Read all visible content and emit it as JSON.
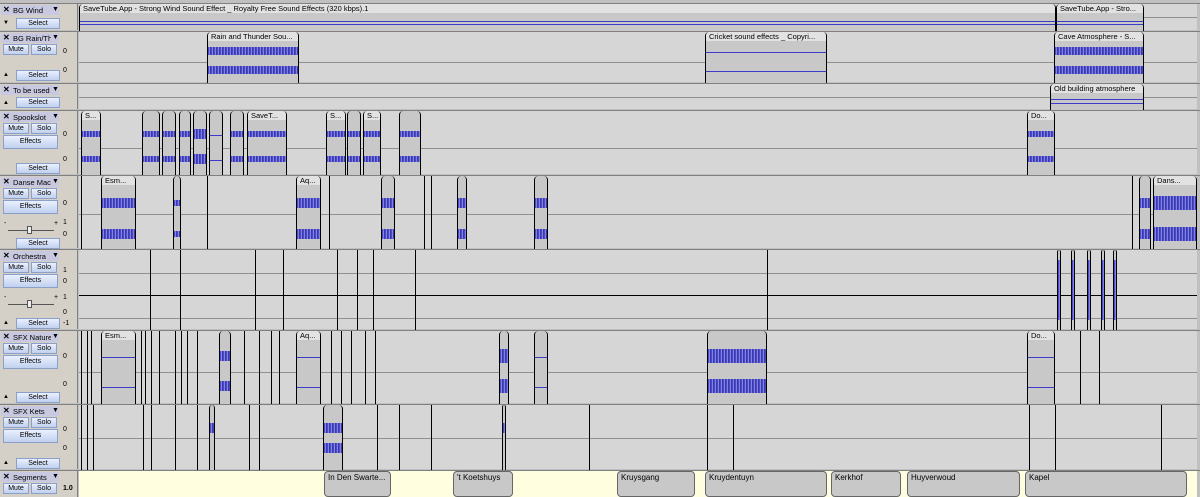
{
  "tracks": [
    {
      "name": "BG Wind",
      "select": "Select"
    },
    {
      "name": "BG Rain/Thu",
      "mute": "Mute",
      "solo": "Solo",
      "select": "Select",
      "scale": [
        "0",
        "0"
      ]
    },
    {
      "name": "To be used",
      "select": "Select"
    },
    {
      "name": "Spookslot",
      "mute": "Mute",
      "solo": "Solo",
      "effects": "Effects",
      "select": "Select",
      "scale": [
        "0",
        "0"
      ]
    },
    {
      "name": "Danse Maca",
      "mute": "Mute",
      "solo": "Solo",
      "effects": "Effects",
      "select": "Select",
      "slider_minus": "-",
      "slider_plus": "+",
      "scale": [
        "0",
        "1",
        "0"
      ]
    },
    {
      "name": "Orchestra",
      "mute": "Mute",
      "solo": "Solo",
      "effects": "Effects",
      "select": "Select",
      "slider_minus": "-",
      "slider_plus": "+",
      "scale": [
        "1",
        "0",
        "1",
        "0",
        "-1"
      ]
    },
    {
      "name": "SFX Nature",
      "mute": "Mute",
      "solo": "Solo",
      "effects": "Effects",
      "select": "Select",
      "scale": [
        "0",
        "0"
      ]
    },
    {
      "name": "SFX Kets",
      "mute": "Mute",
      "solo": "Solo",
      "effects": "Effects",
      "select": "Select",
      "scale": [
        "0",
        "0"
      ]
    },
    {
      "name": "Segments",
      "mute": "Mute",
      "solo": "Solo",
      "scale": [
        "1.0"
      ]
    }
  ],
  "clips": {
    "wind": [
      "SaveTube.App - Strong Wind Sound Effect _ Royalty Free Sound Effects (320 kbps).1",
      "SaveTube.App - Stro..."
    ],
    "rain": [
      "Rain and Thunder Sou...",
      "Cricket sound effects _ Copyri...",
      "Cave Atmosphere - S..."
    ],
    "tobeused": [
      "Old building atmosphere"
    ],
    "spook": [
      "S...",
      "SaveT...",
      "S...",
      "S...",
      "Do..."
    ],
    "danse": [
      "Esm...",
      "Aq...",
      "Dans..."
    ],
    "nature": [
      "Esm...",
      "Aq...",
      "Do..."
    ]
  },
  "segments": [
    "In Den Swarte...",
    "'t Koetshuys",
    "Kruysgang",
    "Kruydentuyn",
    "Kerkhof",
    "Huyverwoud",
    "Kapel"
  ],
  "colors": {
    "waveform": "#3c3cc8",
    "track_bg": "#d6d6d6",
    "clip_bg": "#c8c8c8",
    "header_bg": "#c8c8e0",
    "label_track_bg": "#ffffe0"
  }
}
